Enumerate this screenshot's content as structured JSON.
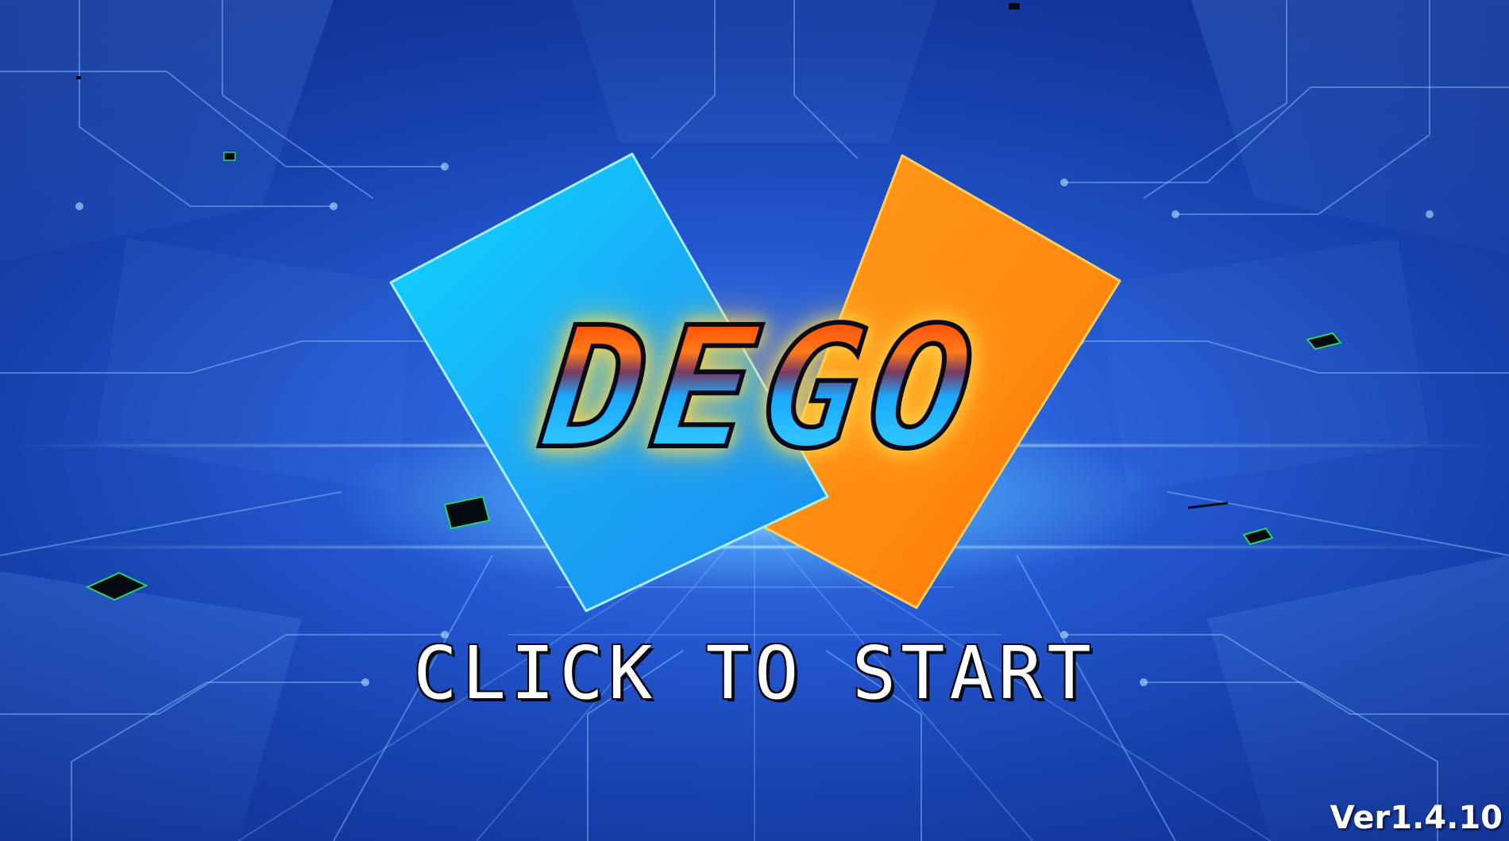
{
  "title": {
    "logo_text": "DEGO"
  },
  "start_prompt": {
    "label": "CLICK TO START"
  },
  "version": {
    "label": "Ver1.4.10"
  },
  "colors": {
    "card_left": "#16a8f8",
    "card_right": "#ff8a10",
    "background": "#1f4fc8",
    "logo_glow": "#ffd84a"
  }
}
